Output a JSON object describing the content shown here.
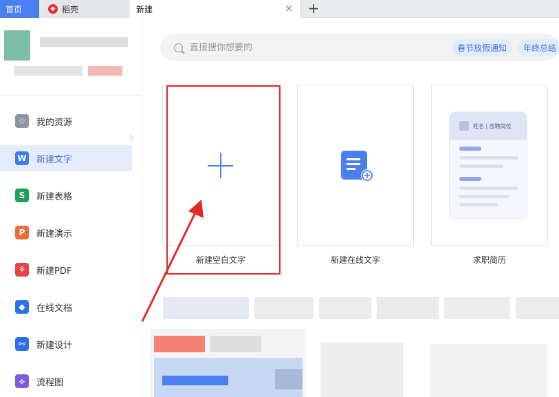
{
  "tabs": {
    "home": "首页",
    "daoke": "稻壳",
    "new": "新建",
    "close": "×",
    "add": "+"
  },
  "sidebar": {
    "items": [
      {
        "label": "我的资源",
        "icon": "star-icon",
        "color": "#8c95a8"
      },
      {
        "label": "新建文字",
        "icon": "writer-icon",
        "color": "#3d7cf0"
      },
      {
        "label": "新建表格",
        "icon": "spreadsheet-icon",
        "color": "#1fa35c"
      },
      {
        "label": "新建演示",
        "icon": "presentation-icon",
        "color": "#ec6b3a"
      },
      {
        "label": "新建PDF",
        "icon": "pdf-icon",
        "color": "#e64545"
      },
      {
        "label": "在线文档",
        "icon": "online-doc-icon",
        "color": "#2f6fe8"
      },
      {
        "label": "新建设计",
        "icon": "design-icon",
        "color": "#2f6fe8"
      },
      {
        "label": "流程图",
        "icon": "flowchart-icon",
        "color": "#7b5de0"
      }
    ],
    "active_index": 1
  },
  "search": {
    "placeholder": "直接搜你想要的",
    "chips": [
      "春节放假通知",
      "年终总结"
    ]
  },
  "cards": [
    {
      "label": "新建空白文字"
    },
    {
      "label": "新建在线文字"
    },
    {
      "label": "求职简历"
    }
  ],
  "resume": {
    "header": "姓名 | 应聘岗位"
  },
  "colors": {
    "accent": "#4a7ff0",
    "highlight": "#e02a2a"
  }
}
